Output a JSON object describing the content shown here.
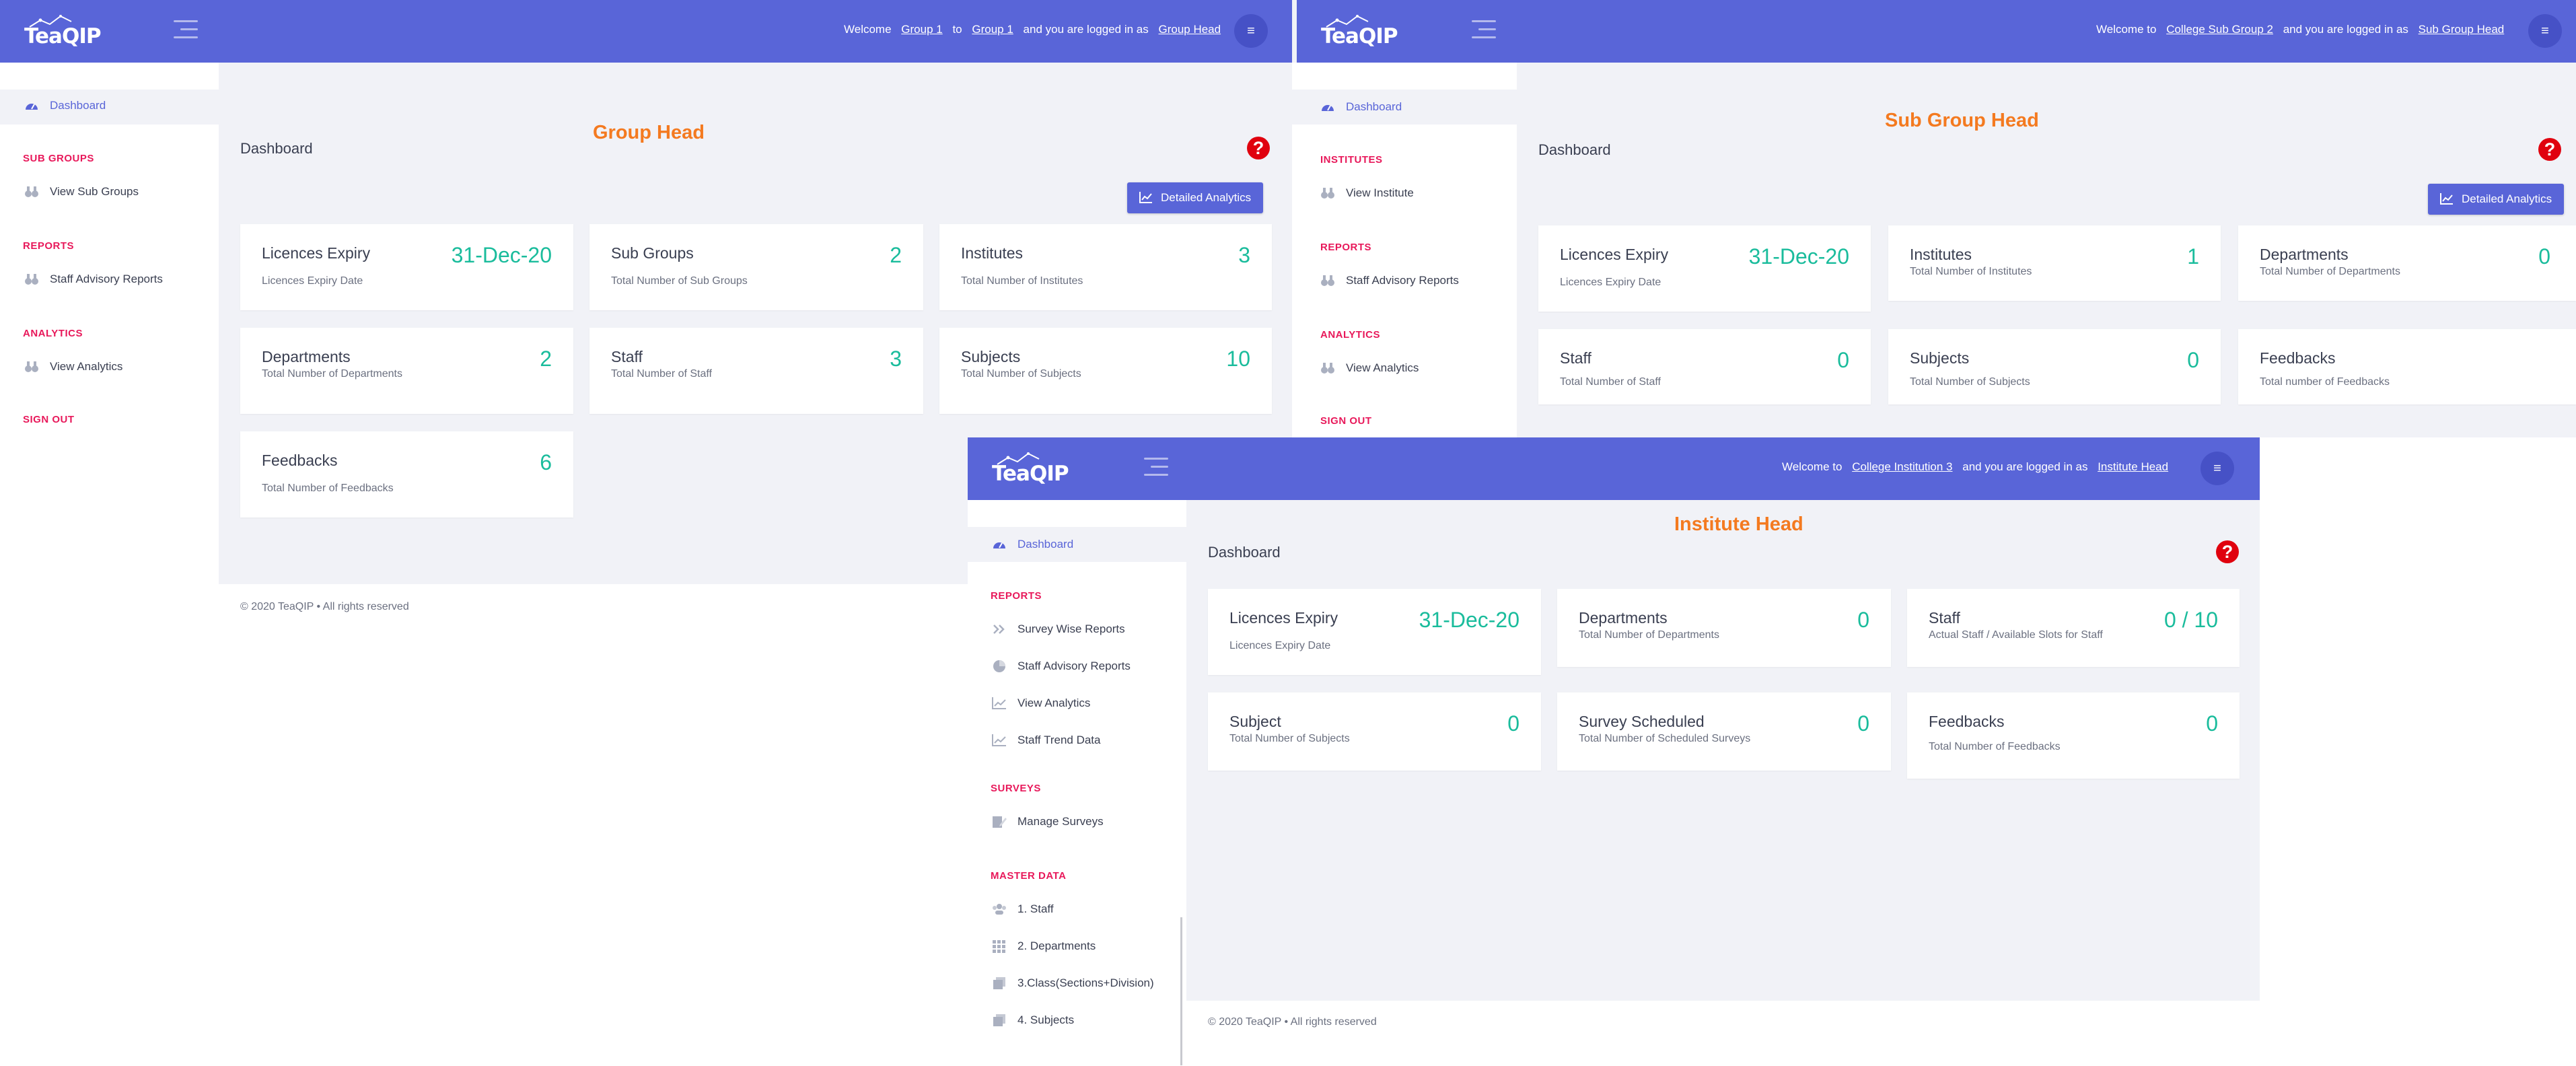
{
  "brand": "TeaQIP",
  "colors": {
    "topbar": "#5965d8",
    "accent_value": "#1abc9c",
    "role_title": "#f47a20",
    "section_head": "#e8185a",
    "help": "#e0010e"
  },
  "shared": {
    "dashboard_label": "Dashboard",
    "menu_icon": "≡",
    "help_glyph": "?",
    "analytics_button": "Detailed Analytics",
    "footer": "©  2020  TeaQIP  •  All rights reserved"
  },
  "group": {
    "welcome_pre": "Welcome",
    "entity": "Group 1",
    "to": "to",
    "entity2": "Group 1",
    "logged": "and you are logged in as",
    "role_link": "Group Head",
    "role_title": "Group Head",
    "sidebar": {
      "dashboard": "Dashboard",
      "sections": [
        {
          "heading": "SUB GROUPS",
          "item": "View Sub Groups"
        },
        {
          "heading": "REPORTS",
          "item": "Staff Advisory Reports"
        },
        {
          "heading": "ANALYTICS",
          "item": "View Analytics"
        }
      ],
      "signout": "SIGN OUT"
    },
    "cards": [
      {
        "title": "Licences Expiry",
        "sub": "Licences Expiry Date",
        "value": "31-Dec-20"
      },
      {
        "title": "Sub Groups",
        "sub": "Total Number of Sub Groups",
        "value": "2"
      },
      {
        "title": "Institutes",
        "sub": "Total Number of Institutes",
        "value": "3"
      },
      {
        "title": "Departments",
        "sub": "Total Number of Departments",
        "value": "2"
      },
      {
        "title": "Staff",
        "sub": "Total Number of Staff",
        "value": "3"
      },
      {
        "title": "Subjects",
        "sub": "Total Number of Subjects",
        "value": "10"
      },
      {
        "title": "Feedbacks",
        "sub": "Total Number of Feedbacks",
        "value": "6"
      }
    ]
  },
  "subgroup": {
    "welcome_pre": "Welcome to",
    "entity": "College Sub Group 2",
    "logged": "and you are logged in as",
    "role_link": "Sub Group Head",
    "role_title": "Sub Group Head",
    "sidebar": {
      "dashboard": "Dashboard",
      "sections": [
        {
          "heading": "INSTITUTES",
          "item": "View Institute"
        },
        {
          "heading": "REPORTS",
          "item": "Staff Advisory Reports"
        },
        {
          "heading": "ANALYTICS",
          "item": "View Analytics"
        }
      ],
      "signout": "SIGN OUT"
    },
    "cards": [
      {
        "title": "Licences Expiry",
        "sub": "Licences Expiry Date",
        "value": "31-Dec-20"
      },
      {
        "title": "Institutes",
        "sub": "Total Number of Institutes",
        "value": "1"
      },
      {
        "title": "Departments",
        "sub": "Total Number of Departments",
        "value": "0"
      },
      {
        "title": "Staff",
        "sub": "Total Number of Staff",
        "value": "0"
      },
      {
        "title": "Subjects",
        "sub": "Total Number of Subjects",
        "value": "0"
      },
      {
        "title": "Feedbacks",
        "sub": "Total number of Feedbacks",
        "value": ""
      }
    ]
  },
  "institute": {
    "welcome_pre": "Welcome to",
    "entity": "College Institution 3",
    "logged": "and you are logged in as",
    "role_link": "Institute Head",
    "role_title": "Institute Head",
    "sidebar": {
      "dashboard": "Dashboard",
      "reports_heading": "REPORTS",
      "reports": [
        "Survey Wise Reports",
        "Staff Advisory Reports",
        "View Analytics",
        "Staff Trend Data"
      ],
      "surveys_heading": "SURVEYS",
      "surveys": [
        "Manage Surveys"
      ],
      "master_heading": "MASTER DATA",
      "master": [
        "1. Staff",
        "2. Departments",
        "3.Class(Sections+Division)",
        "4. Subjects"
      ]
    },
    "cards": [
      {
        "title": "Licences Expiry",
        "sub": "Licences Expiry Date",
        "value": "31-Dec-20"
      },
      {
        "title": "Departments",
        "sub": "Total Number of Departments",
        "value": "0"
      },
      {
        "title": "Staff",
        "sub": "Actual Staff / Available Slots for Staff",
        "value": "0 / 10"
      },
      {
        "title": "Subject",
        "sub": "Total Number of Subjects",
        "value": "0"
      },
      {
        "title": "Survey Scheduled",
        "sub": "Total Number of Scheduled Surveys",
        "value": "0"
      },
      {
        "title": "Feedbacks",
        "sub": "Total Number of Feedbacks",
        "value": "0"
      }
    ]
  }
}
